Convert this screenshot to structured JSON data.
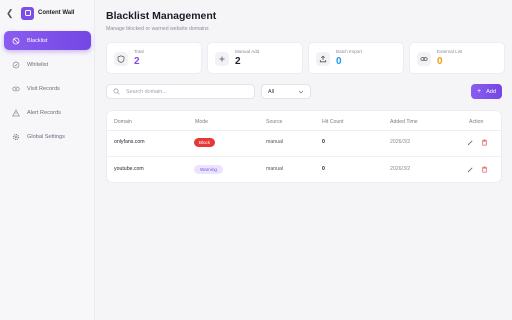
{
  "sidebar": {
    "back_icon": "chevron-left",
    "brand": "Content Wall",
    "items": [
      {
        "label": "Blacklist",
        "icon": "block-icon",
        "active": true
      },
      {
        "label": "Whitelist",
        "icon": "check-circle-icon"
      },
      {
        "label": "Visit Records",
        "icon": "eye-icon"
      },
      {
        "label": "Alert Records",
        "icon": "warning-icon"
      },
      {
        "label": "Global Settings",
        "icon": "gear-icon"
      }
    ]
  },
  "header": {
    "title": "Blacklist Management",
    "subtitle": "Manage blocked or warned website domains"
  },
  "stats": [
    {
      "label": "Total",
      "value": "2",
      "color": "#7c4ee8",
      "icon": "shield-icon"
    },
    {
      "label": "Manual Add",
      "value": "2",
      "color": "#1f1f2e",
      "icon": "plus-icon"
    },
    {
      "label": "Batch Import",
      "value": "0",
      "color": "#1a9be6",
      "icon": "upload-icon"
    },
    {
      "label": "External List",
      "value": "0",
      "color": "#f39c12",
      "icon": "link-icon"
    }
  ],
  "toolbar": {
    "search_placeholder": "Search domain...",
    "filter_value": "All",
    "add_label": "Add"
  },
  "table": {
    "columns": [
      "Domain",
      "Mode",
      "Source",
      "Hit Count",
      "Added Time",
      "Action"
    ],
    "rows": [
      {
        "domain": "onlyfans.com",
        "mode": "Block",
        "source": "manual",
        "hits": "0",
        "added": "2026/3/2"
      },
      {
        "domain": "youtube.com",
        "mode": "Warning",
        "source": "manual",
        "hits": "0",
        "added": "2026/3/2"
      }
    ]
  },
  "colors": {
    "accent": "#7c4ee8",
    "danger": "#e53935"
  }
}
